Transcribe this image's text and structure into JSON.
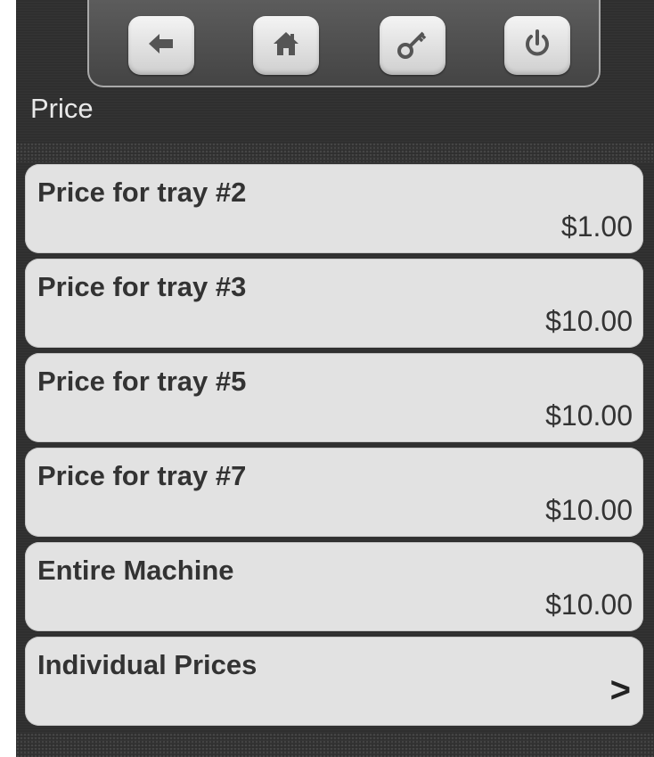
{
  "header": {
    "title": "Price",
    "buttons": [
      {
        "name": "back",
        "icon": "arrow-left-icon"
      },
      {
        "name": "home",
        "icon": "home-icon"
      },
      {
        "name": "key",
        "icon": "key-icon"
      },
      {
        "name": "power",
        "icon": "power-icon"
      }
    ]
  },
  "items": [
    {
      "label": "Price for tray #2",
      "value": "$1.00"
    },
    {
      "label": "Price for tray #3",
      "value": "$10.00"
    },
    {
      "label": "Price for tray #5",
      "value": "$10.00"
    },
    {
      "label": "Price for tray #7",
      "value": "$10.00"
    },
    {
      "label": "Entire Machine",
      "value": "$10.00"
    },
    {
      "label": "Individual Prices",
      "chevron": ">"
    }
  ],
  "colors": {
    "background": "#2f2f2f",
    "item_bg": "#e2e2e2",
    "text": "#333333"
  }
}
